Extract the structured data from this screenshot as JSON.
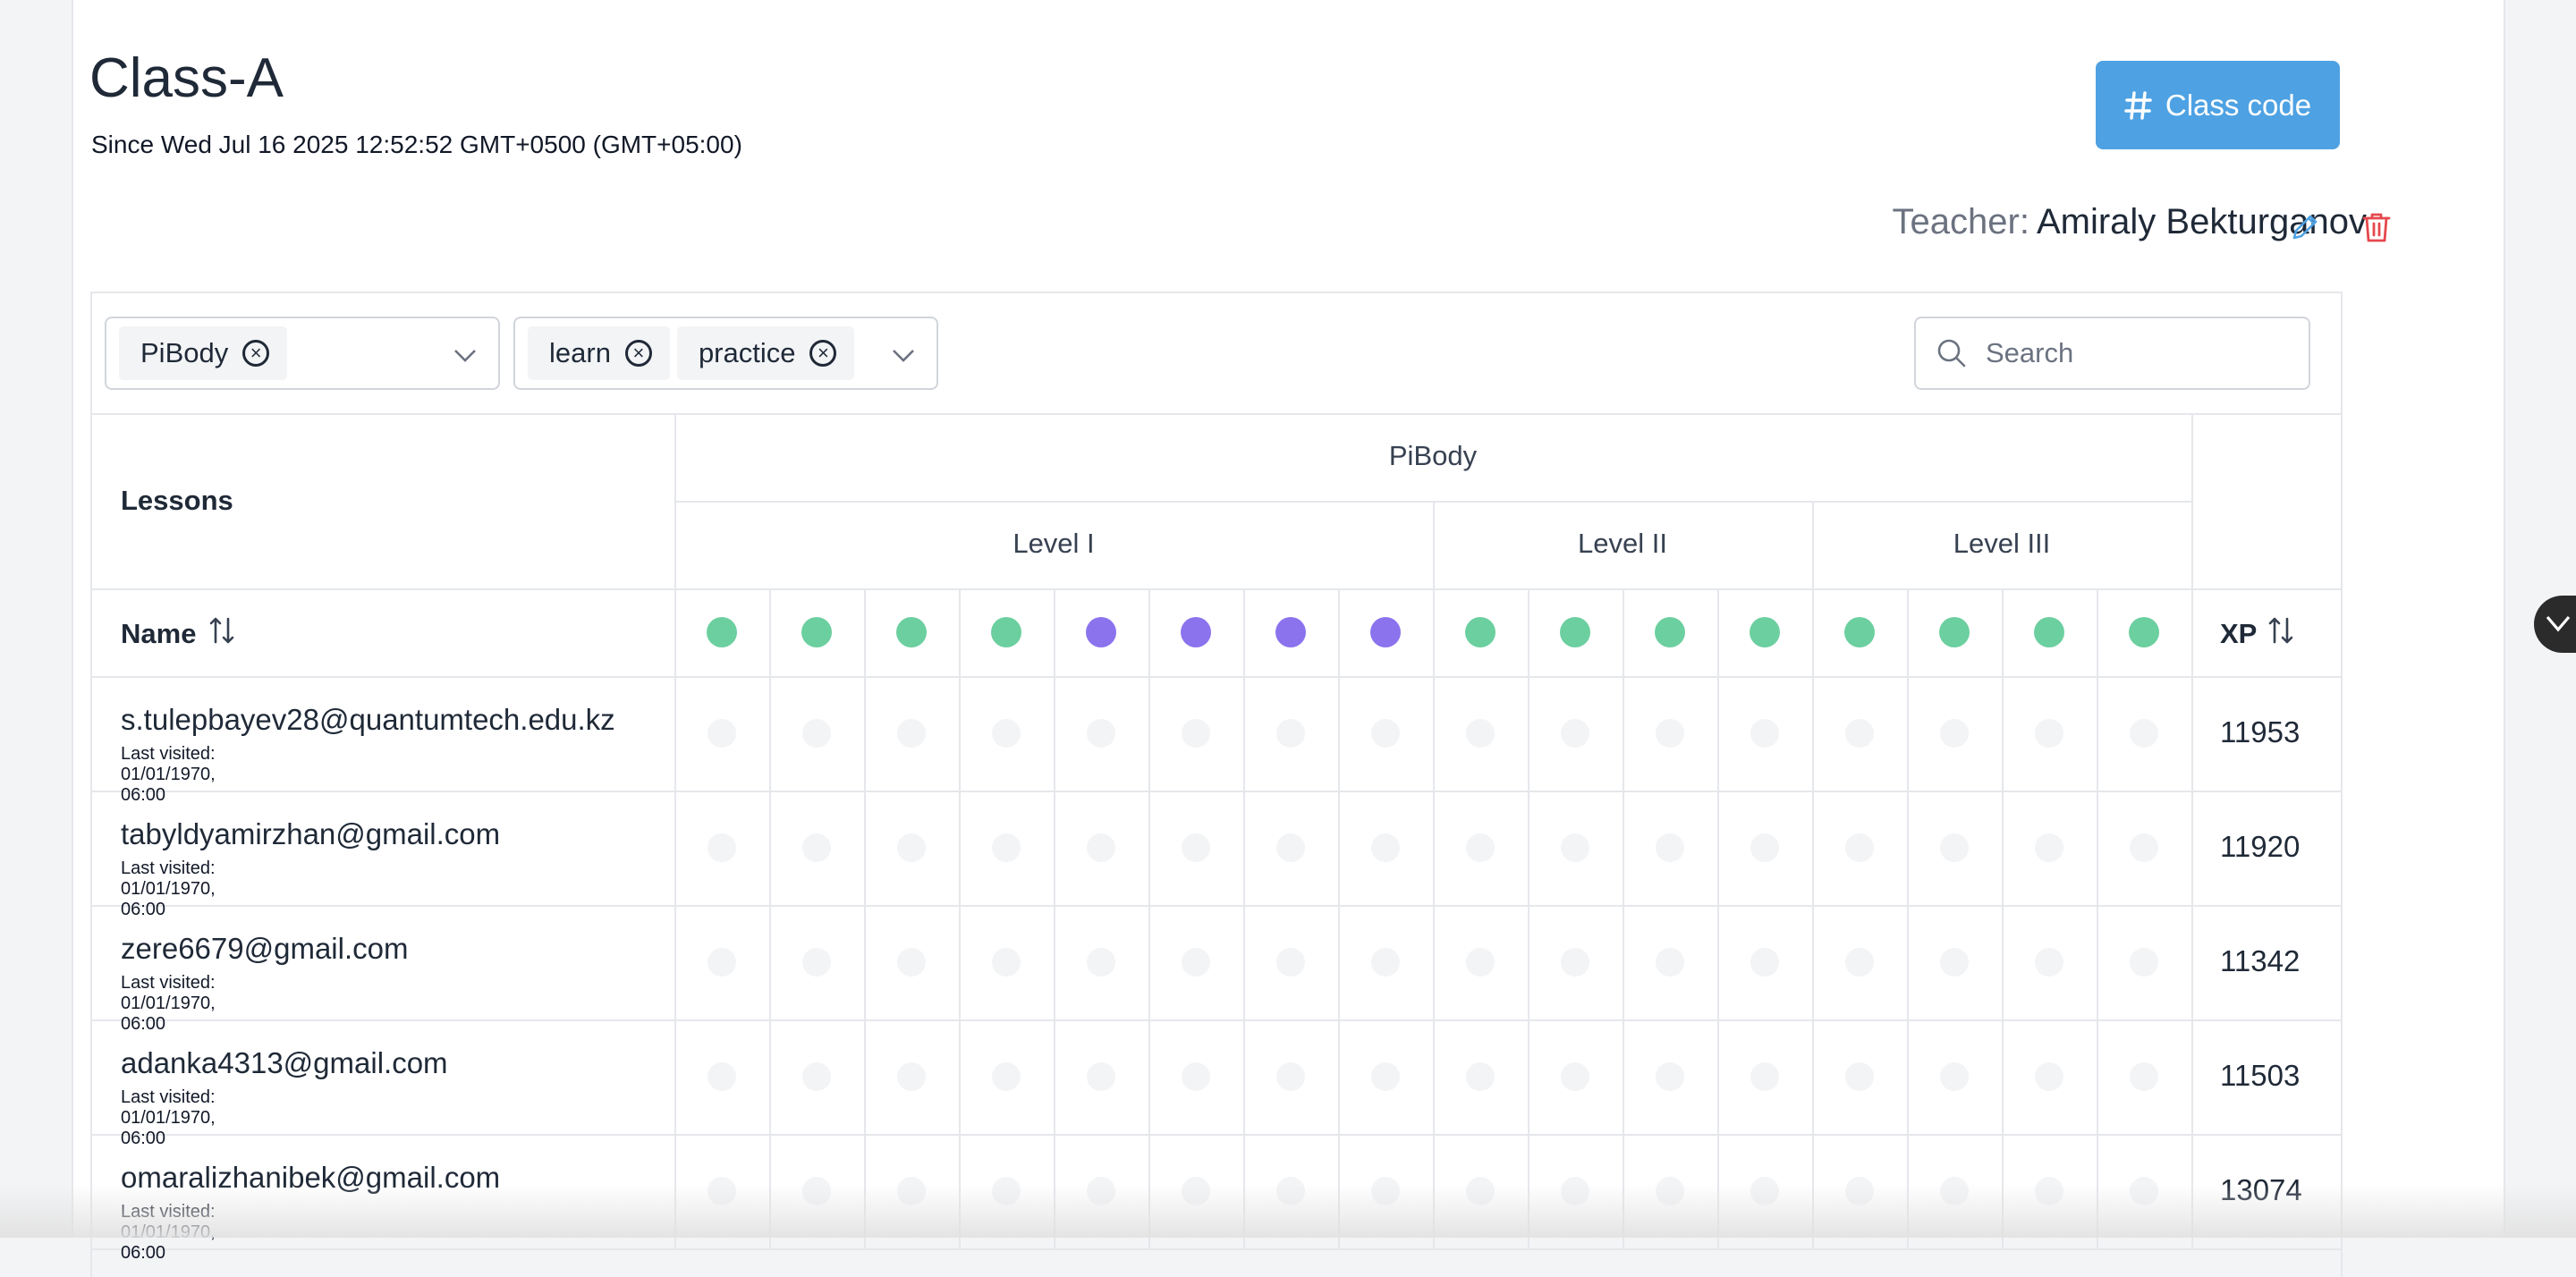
{
  "header": {
    "title": "Class-A",
    "since": "Since Wed Jul 16 2025 12:52:52 GMT+0500 (GMT+05:00)",
    "class_code_label": "Class code",
    "teacher_label": "Teacher:",
    "teacher_name": "Amiraly Bekturganov"
  },
  "filters": {
    "course_chips": [
      "PiBody"
    ],
    "type_chips": [
      "learn",
      "practice"
    ],
    "search_placeholder": "Search"
  },
  "table": {
    "lessons_label": "Lessons",
    "course": "PiBody",
    "levels": [
      {
        "label": "Level I",
        "lessons": 8
      },
      {
        "label": "Level II",
        "lessons": 4
      },
      {
        "label": "Level III",
        "lessons": 4
      }
    ],
    "name_header": "Name",
    "xp_header": "XP",
    "lesson_types": [
      "learn",
      "learn",
      "learn",
      "learn",
      "practice",
      "practice",
      "practice",
      "practice",
      "learn",
      "learn",
      "learn",
      "learn",
      "learn",
      "learn",
      "learn",
      "learn"
    ],
    "rows": [
      {
        "email": "s.tulepbayev28@quantumtech.edu.kz",
        "visited": "Last visited: 01/01/1970, 06:00",
        "xp": "11953"
      },
      {
        "email": "tabyldyamirzhan@gmail.com",
        "visited": "Last visited: 01/01/1970, 06:00",
        "xp": "11920"
      },
      {
        "email": "zere6679@gmail.com",
        "visited": "Last visited: 01/01/1970, 06:00",
        "xp": "11342"
      },
      {
        "email": "adanka4313@gmail.com",
        "visited": "Last visited: 01/01/1970, 06:00",
        "xp": "11503"
      },
      {
        "email": "omaralizhanibek@gmail.com",
        "visited": "Last visited: 01/01/1970, 06:00",
        "xp": "13074"
      }
    ]
  },
  "colors": {
    "accent": "#4ea2e3",
    "learn_dot": "#6ccf9f",
    "practice_dot": "#8b73ee",
    "empty_dot": "#f3f4f6",
    "delete": "#e5484d"
  }
}
